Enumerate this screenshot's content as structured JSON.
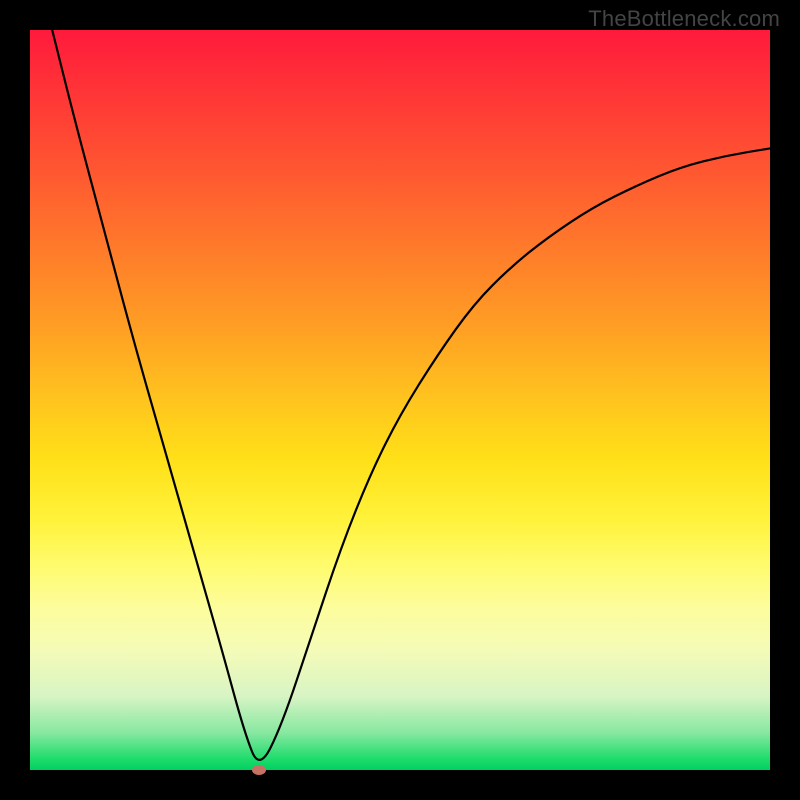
{
  "watermark": "TheBottleneck.com",
  "chart_data": {
    "type": "line",
    "title": "",
    "xlabel": "",
    "ylabel": "",
    "xlim": [
      0,
      100
    ],
    "ylim": [
      0,
      100
    ],
    "minimum": {
      "x": 31,
      "y": 0
    },
    "series": [
      {
        "name": "bottleneck-curve",
        "x": [
          3,
          6,
          10,
          14,
          18,
          22,
          26,
          29,
          31,
          34,
          38,
          42,
          46,
          50,
          55,
          60,
          65,
          70,
          76,
          82,
          88,
          94,
          100
        ],
        "y": [
          100,
          88,
          73,
          58,
          44,
          30,
          16,
          5,
          0,
          6,
          18,
          30,
          40,
          48,
          56,
          63,
          68,
          72,
          76,
          79,
          81.5,
          83,
          84
        ]
      }
    ],
    "background_gradient": {
      "top_color": "#ff1a3c",
      "mid_color": "#ffe018",
      "bottom_color": "#00d060"
    }
  }
}
